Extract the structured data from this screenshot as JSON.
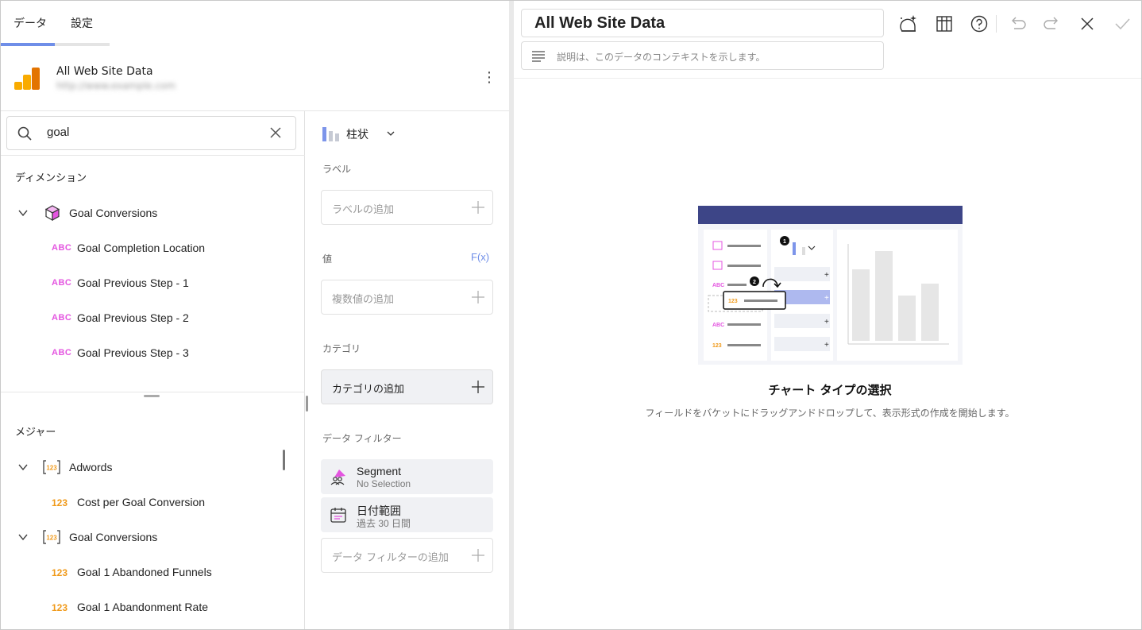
{
  "tabs": [
    {
      "label": "データ"
    },
    {
      "label": "設定"
    }
  ],
  "datasource": {
    "name": "All Web Site Data",
    "subtitle": "http://www.example.com"
  },
  "search": {
    "value": "goal"
  },
  "dimensions": {
    "title": "ディメンション",
    "group": "Goal Conversions",
    "items": [
      "Goal Completion Location",
      "Goal Previous Step - 1",
      "Goal Previous Step - 2",
      "Goal Previous Step - 3"
    ],
    "type_label": "ABC"
  },
  "measures": {
    "title": "メジャー",
    "type_label": "123",
    "groups": [
      {
        "name": "Adwords",
        "items": [
          "Cost per Goal Conversion"
        ]
      },
      {
        "name": "Goal Conversions",
        "items": [
          "Goal 1 Abandoned Funnels",
          "Goal 1 Abandonment Rate"
        ]
      }
    ]
  },
  "config": {
    "chart_type": "柱状",
    "label_section": "ラベル",
    "label_placeholder": "ラベルの追加",
    "values_section": "値",
    "fx": "F(x)",
    "values_placeholder": "複数値の追加",
    "category_section": "カテゴリ",
    "category_placeholder": "カテゴリの追加",
    "filter_section": "データ フィルター",
    "filters": [
      {
        "title": "Segment",
        "subtitle": "No Selection",
        "icon": "segment-icon"
      },
      {
        "title": "日付範囲",
        "subtitle": "過去 30 日間",
        "icon": "calendar-icon"
      }
    ],
    "filter_placeholder": "データ フィルターの追加"
  },
  "editor": {
    "title": "All Web Site Data",
    "description_placeholder": "説明は、このデータのコンテキストを示します。",
    "empty_title": "チャート タイプの選択",
    "empty_subtitle": "フィールドをバケットにドラッグアンドドロップして、表示形式の作成を開始します。"
  },
  "colors": {
    "accent": "#6f8ee8",
    "dimension": "#e455e0",
    "measure": "#f09a1a",
    "illustration_header": "#3d4587"
  }
}
